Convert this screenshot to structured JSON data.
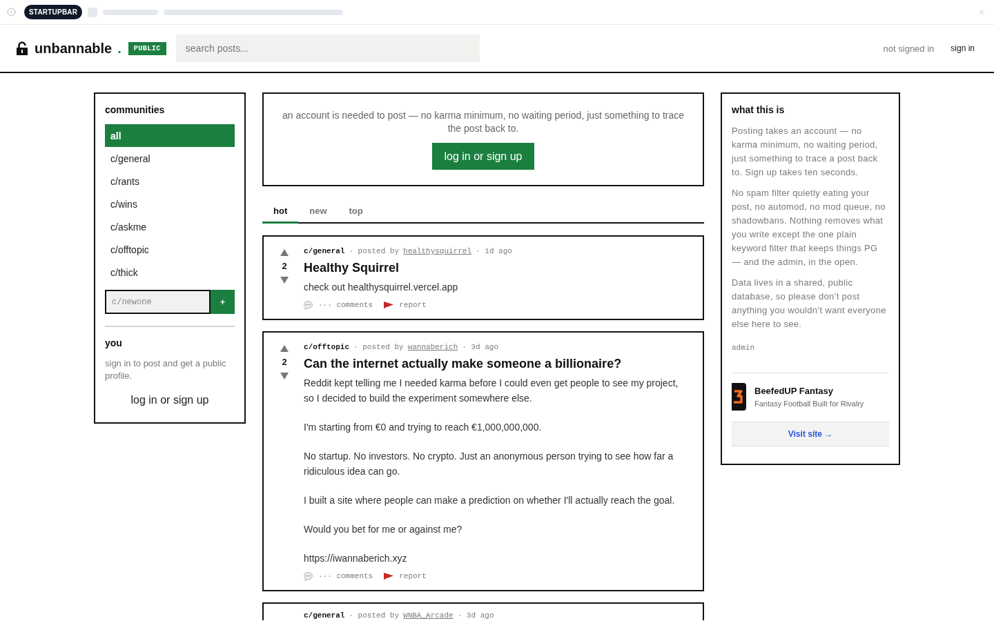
{
  "top_bar": {
    "badge": "STARTUPBAR"
  },
  "header": {
    "brand": "unbannable",
    "brand_dot": ".",
    "badge": "PUBLIC",
    "search": {
      "placeholder": "search posts..."
    },
    "status": "not signed in",
    "sign_in": "sign in"
  },
  "sidebar": {
    "title": "communities",
    "items": [
      {
        "label": "all",
        "selected": true
      },
      {
        "label": "c/general",
        "selected": false
      },
      {
        "label": "c/rants",
        "selected": false
      },
      {
        "label": "c/wins",
        "selected": false
      },
      {
        "label": "c/askme",
        "selected": false
      },
      {
        "label": "c/offtopic",
        "selected": false
      },
      {
        "label": "c/thick",
        "selected": false
      }
    ],
    "new_community": {
      "placeholder": "c/newone",
      "button": "+"
    },
    "you": {
      "title": "you",
      "text": "sign in to post and get a public profile.",
      "link": "log in or sign up"
    }
  },
  "notice": {
    "text": "an account is needed to post — no karma minimum, no waiting period, just something to trace the post back to.",
    "button": "log in or sign up"
  },
  "tabs": [
    {
      "label": "hot",
      "selected": true
    },
    {
      "label": "new",
      "selected": false
    },
    {
      "label": "top",
      "selected": false
    }
  ],
  "posts": [
    {
      "score": "2",
      "community": "c/general",
      "byline": "· posted by",
      "author": "healthysquirrel",
      "time": "· 1d ago",
      "title": "Healthy Squirrel",
      "body": [
        "check out healthysquirrel.vercel.app"
      ],
      "comments": "··· comments",
      "report": "report"
    },
    {
      "score": "2",
      "community": "c/offtopic",
      "byline": "· posted by",
      "author": "wannaberich",
      "time": "· 3d ago",
      "title": "Can the internet actually make someone a billionaire?",
      "body": [
        "Reddit kept telling me I needed karma before I could even get people to see my project, so I decided to build the experiment somewhere else.",
        "I'm starting from €0 and trying to reach €1,000,000,000.",
        "No startup. No investors. No crypto. Just an anonymous person trying to see how far a ridiculous idea can go.",
        "I built a site where people can make a prediction on whether I'll actually reach the goal.",
        "Would you bet for me or against me?",
        "https://iwannaberich.xyz"
      ],
      "comments": "··· comments",
      "report": "report"
    },
    {
      "community": "c/general",
      "byline": "· posted by",
      "author": "WNBA_Arcade",
      "time": "· 3d ago"
    }
  ],
  "about": {
    "title": "what this is",
    "paragraphs": [
      "Posting takes an account — no karma minimum, no waiting period, just something to trace a post back to. Sign up takes ten seconds.",
      "No spam filter quietly eating your post, no automod, no mod queue, no shadowbans. Nothing removes what you write except the one plain keyword filter that keeps things PG — and the admin, in the open.",
      "Data lives in a shared, public database, so please don’t post anything you wouldn’t want everyone else here to see."
    ],
    "signature": "admin"
  },
  "ad": {
    "name": "BeefedUP Fantasy",
    "tagline": "Fantasy Football Built for Rivalry",
    "button": "Visit site →"
  }
}
